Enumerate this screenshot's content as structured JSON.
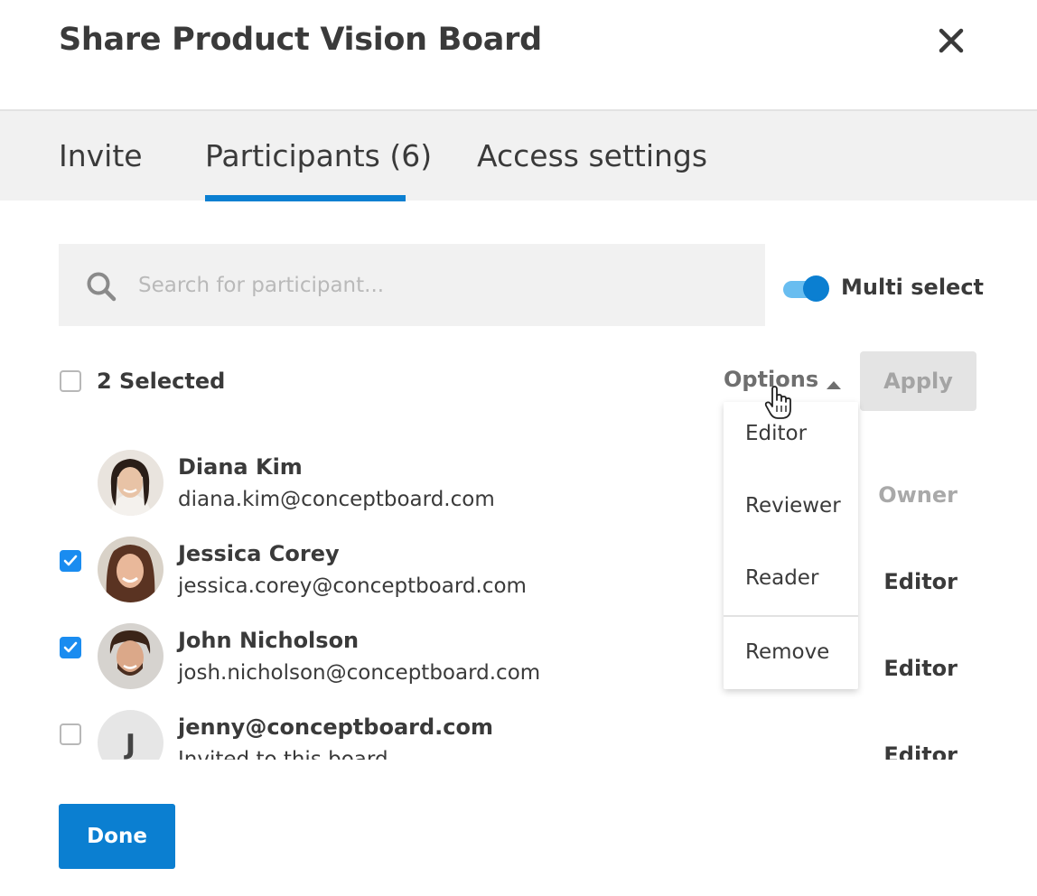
{
  "dialog": {
    "title": "Share Product Vision Board"
  },
  "tabs": [
    {
      "label": "Invite",
      "active": false
    },
    {
      "label": "Participants (6)",
      "active": true
    },
    {
      "label": "Access settings",
      "active": false
    }
  ],
  "colors": {
    "accent": "#0b7fd1",
    "checkbox_checked": "#1a8cf0",
    "tab_bar_bg": "#f1f1f1"
  },
  "search": {
    "placeholder": "Search for participant...",
    "value": ""
  },
  "multi_select": {
    "label": "Multi select",
    "enabled": true
  },
  "selection": {
    "label": "2 Selected",
    "all_checked": false
  },
  "options": {
    "label": "Options",
    "expanded": true,
    "items": [
      "Editor",
      "Reviewer",
      "Reader"
    ],
    "remove_label": "Remove"
  },
  "apply_label": "Apply",
  "participants": [
    {
      "name": "Diana Kim",
      "email": "diana.kim@conceptboard.com",
      "role": "Owner",
      "checked": null,
      "avatar": "photo"
    },
    {
      "name": "Jessica Corey",
      "email": "jessica.corey@conceptboard.com",
      "role": "Editor",
      "checked": true,
      "avatar": "photo"
    },
    {
      "name": "John Nicholson",
      "email": "josh.nicholson@conceptboard.com",
      "role": "Editor",
      "checked": true,
      "avatar": "photo"
    },
    {
      "name": "jenny@conceptboard.com",
      "email": "Invited to this board",
      "role": "Editor",
      "checked": false,
      "avatar": "J"
    }
  ],
  "done_label": "Done",
  "icons": {
    "close": "close-icon",
    "search": "search-icon",
    "caret": "caret-up-icon",
    "cursor": "hand-pointer-icon"
  }
}
